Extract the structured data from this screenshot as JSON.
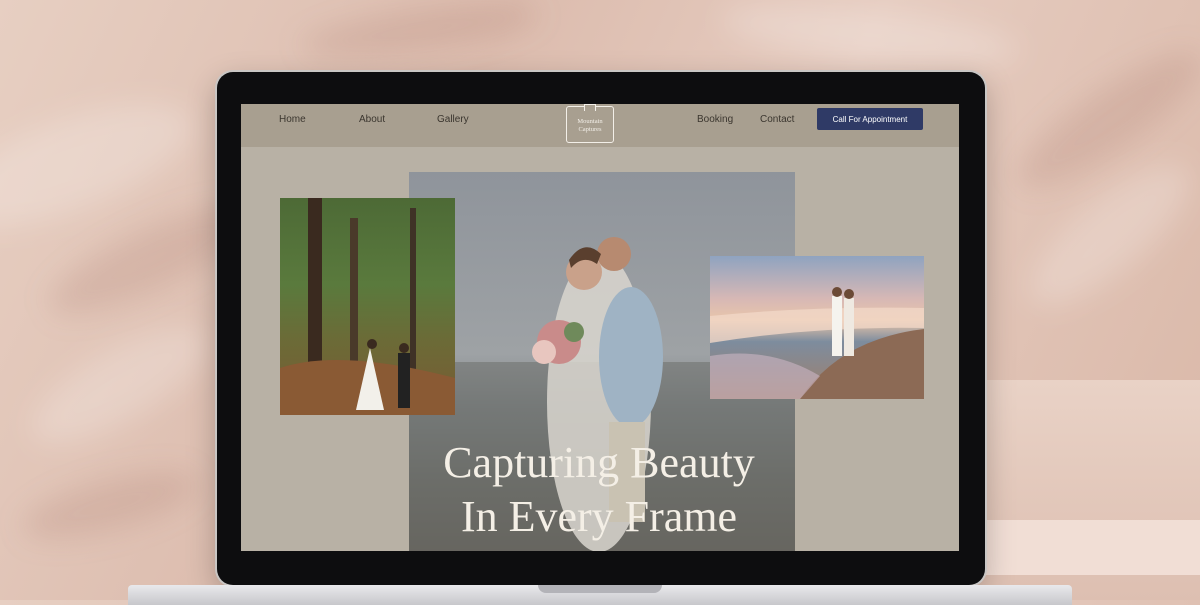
{
  "nav": {
    "links": [
      "Home",
      "About",
      "Gallery",
      "Booking",
      "Contact"
    ],
    "logo": [
      "Mountain",
      "Captures"
    ],
    "cta_label": "Call For Appointment"
  },
  "hero": {
    "title_line1": "Capturing Beauty",
    "title_line2": "In Every Frame"
  },
  "colors": {
    "nav_bg": "#a89f90",
    "page_bg": "#b8b1a5",
    "cta_bg": "#2f3a66",
    "title_color": "#f4efe6"
  },
  "images": {
    "center": "couple-embracing-beach-photo",
    "left": "couple-walking-forest-photo",
    "right": "couple-sunset-beach-photo"
  }
}
